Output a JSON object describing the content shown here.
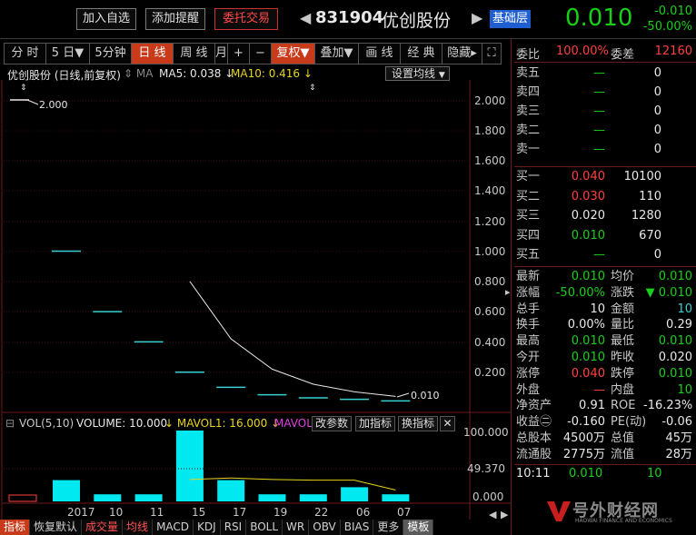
{
  "header": {
    "add_watchlist": "加入自选",
    "add_alert": "添加提醒",
    "order_trade": "委托交易",
    "stock_code": "831904",
    "stock_name": "优创股份",
    "board": "基础层",
    "price": "0.010",
    "change": "-0.010",
    "change_pct": "-50.00%"
  },
  "toolbar": {
    "items": [
      "分 时",
      "5 日▼",
      "5分钟",
      "日 线",
      "周 线",
      "月",
      "+",
      "−",
      "复权▼",
      "叠加▼",
      "画 线",
      "经 典",
      "隐藏▸",
      "⛶"
    ],
    "active_index": 3
  },
  "chart": {
    "title": "优创股份 (日线,前复权)",
    "ma_tag": "MA",
    "ma5": "MA5: 0.038",
    "ma10": "MA10: 0.416",
    "ma_settings": "设置均线",
    "hi_label": "2.000",
    "lo_label": "0.010",
    "y_ticks": [
      "2.000",
      "1.800",
      "1.600",
      "1.400",
      "1.200",
      "1.000",
      "0.800",
      "0.600",
      "0.400",
      "0.200"
    ]
  },
  "chart_data": {
    "type": "candlestick",
    "x": [
      "2017",
      "10",
      "11",
      "15",
      "17",
      "19",
      "22",
      "06",
      "07"
    ],
    "price": [
      1.0,
      0.6,
      0.4,
      0.2,
      0.1,
      0.05,
      0.03,
      0.02,
      0.01
    ],
    "ma_line": [
      null,
      null,
      null,
      0.8,
      0.42,
      0.22,
      0.12,
      0.07,
      0.04
    ],
    "volume": [
      30,
      10,
      10,
      100,
      30,
      10,
      10,
      20,
      10
    ],
    "vol_ma": [
      null,
      null,
      null,
      31,
      33,
      31,
      30,
      30,
      16
    ],
    "ylim": [
      0,
      2.0
    ]
  },
  "volume": {
    "label": "VOL(5,10)",
    "value": "VOLUME: 10.000",
    "mavol1": "MAVOL1: 16.000",
    "mavol2": "MAVOL2",
    "btn_params": "改参数",
    "btn_add": "加指标",
    "btn_swap": "换指标",
    "y_ticks": [
      "100.000",
      "49.370",
      "0.000"
    ],
    "x_labels": [
      "2017",
      "10",
      "11",
      "15",
      "17",
      "19",
      "22",
      "06",
      "07"
    ]
  },
  "bottom_tabs": [
    "指标",
    "恢复默认",
    "成交量",
    "均线",
    "MACD",
    "KDJ",
    "RSI",
    "BOLL",
    "WR",
    "OBV",
    "BIAS",
    "更多",
    "模板"
  ],
  "right": {
    "weibi_label": "委比",
    "weibi_val": "100.00%",
    "weicha_label": "委差",
    "weicha_val": "12160",
    "sells": [
      {
        "label": "卖五",
        "price": "—",
        "vol": "0"
      },
      {
        "label": "卖四",
        "price": "—",
        "vol": "0"
      },
      {
        "label": "卖三",
        "price": "—",
        "vol": "0"
      },
      {
        "label": "卖二",
        "price": "—",
        "vol": "0"
      },
      {
        "label": "卖一",
        "price": "—",
        "vol": "0"
      }
    ],
    "buys": [
      {
        "label": "买一",
        "price": "0.040",
        "vol": "10100",
        "color": "red"
      },
      {
        "label": "买二",
        "price": "0.030",
        "vol": "110",
        "color": "red"
      },
      {
        "label": "买三",
        "price": "0.020",
        "vol": "1280",
        "color": "white"
      },
      {
        "label": "买四",
        "price": "0.010",
        "vol": "670",
        "color": "green"
      },
      {
        "label": "买五",
        "price": "—",
        "vol": "0",
        "color": "green"
      }
    ],
    "stats": [
      {
        "l1": "最新",
        "v1": "0.010",
        "c1": "green",
        "l2": "均价",
        "v2": "0.010",
        "c2": "green"
      },
      {
        "l1": "涨幅",
        "v1": "-50.00%",
        "c1": "green",
        "l2": "涨跌",
        "v2": "▼ 0.010",
        "c2": "green"
      },
      {
        "l1": "总手",
        "v1": "10",
        "c1": "white",
        "l2": "金额",
        "v2": "10",
        "c2": "cyan"
      },
      {
        "l1": "换手",
        "v1": "0.00%",
        "c1": "white",
        "l2": "量比",
        "v2": "0.29",
        "c2": "white"
      },
      {
        "l1": "最高",
        "v1": "0.010",
        "c1": "green",
        "l2": "最低",
        "v2": "0.010",
        "c2": "green"
      },
      {
        "l1": "今开",
        "v1": "0.010",
        "c1": "green",
        "l2": "昨收",
        "v2": "0.020",
        "c2": "white"
      },
      {
        "l1": "涨停",
        "v1": "0.040",
        "c1": "red",
        "l2": "跌停",
        "v2": "0.010",
        "c2": "green"
      },
      {
        "l1": "外盘",
        "v1": "—",
        "c1": "red",
        "l2": "内盘",
        "v2": "10",
        "c2": "green"
      },
      {
        "l1": "净资产",
        "v1": "0.91",
        "c1": "white",
        "l2": "ROE",
        "v2": "-16.23%",
        "c2": "white"
      },
      {
        "l1": "收益㊁",
        "v1": "-0.160",
        "c1": "white",
        "l2": "PE(动)",
        "v2": "-0.06",
        "c2": "white"
      },
      {
        "l1": "总股本",
        "v1": "4500万",
        "c1": "white",
        "l2": "总值",
        "v2": "45万",
        "c2": "white"
      },
      {
        "l1": "流通股",
        "v1": "2775万",
        "c1": "white",
        "l2": "流值",
        "v2": "28万",
        "c2": "white"
      }
    ],
    "tick_time": "10:11",
    "tick_price": "0.010",
    "tick_vol": "10",
    "logo_main": "号外财经网",
    "logo_sub": "HAOWAI FINANCE AND ECONOMICS"
  },
  "colors": {
    "up": "#ff4040",
    "down": "#18d018",
    "accent": "#c83a1a",
    "cyan": "#38d0d0",
    "yellow": "#e8d41a"
  }
}
